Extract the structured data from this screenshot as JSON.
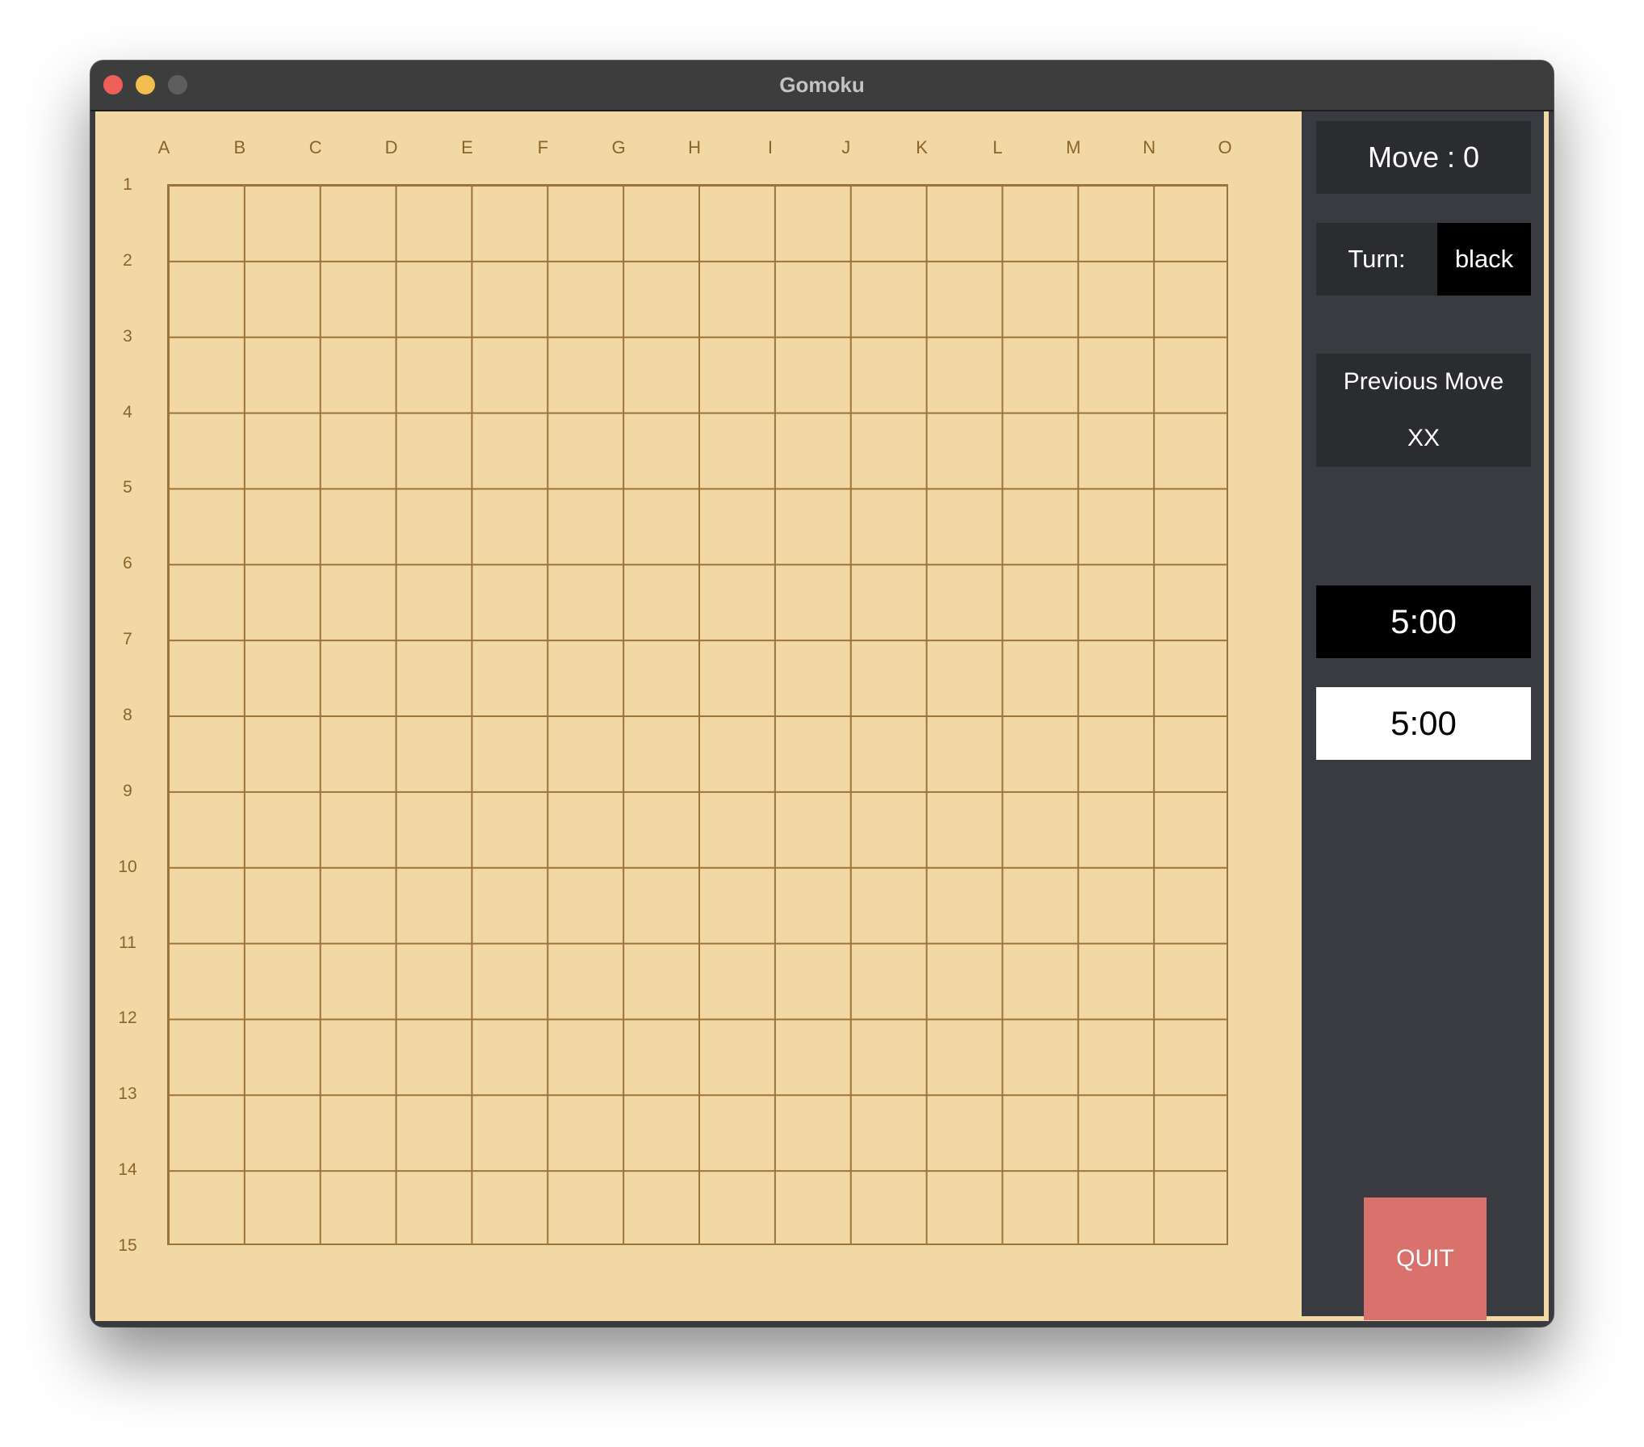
{
  "window": {
    "title": "Gomoku"
  },
  "board": {
    "columns": [
      "A",
      "B",
      "C",
      "D",
      "E",
      "F",
      "G",
      "H",
      "I",
      "J",
      "K",
      "L",
      "M",
      "N",
      "O"
    ],
    "rows": [
      "1",
      "2",
      "3",
      "4",
      "5",
      "6",
      "7",
      "8",
      "9",
      "10",
      "11",
      "12",
      "13",
      "14",
      "15"
    ],
    "colors": {
      "wood": "#f2d8a4",
      "line": "#9c7437",
      "label": "#8a6428"
    }
  },
  "sidebar": {
    "move": "Move : 0",
    "turn_label": "Turn:",
    "turn_value": "black",
    "previous_move_label": "Previous Move",
    "previous_move_value": "XX",
    "timer_black": "5:00",
    "timer_white": "5:00",
    "quit_label": "QUIT",
    "colors": {
      "background": "#3a3b40",
      "panel": "#2b2c30",
      "quit": "#d9716d"
    }
  }
}
